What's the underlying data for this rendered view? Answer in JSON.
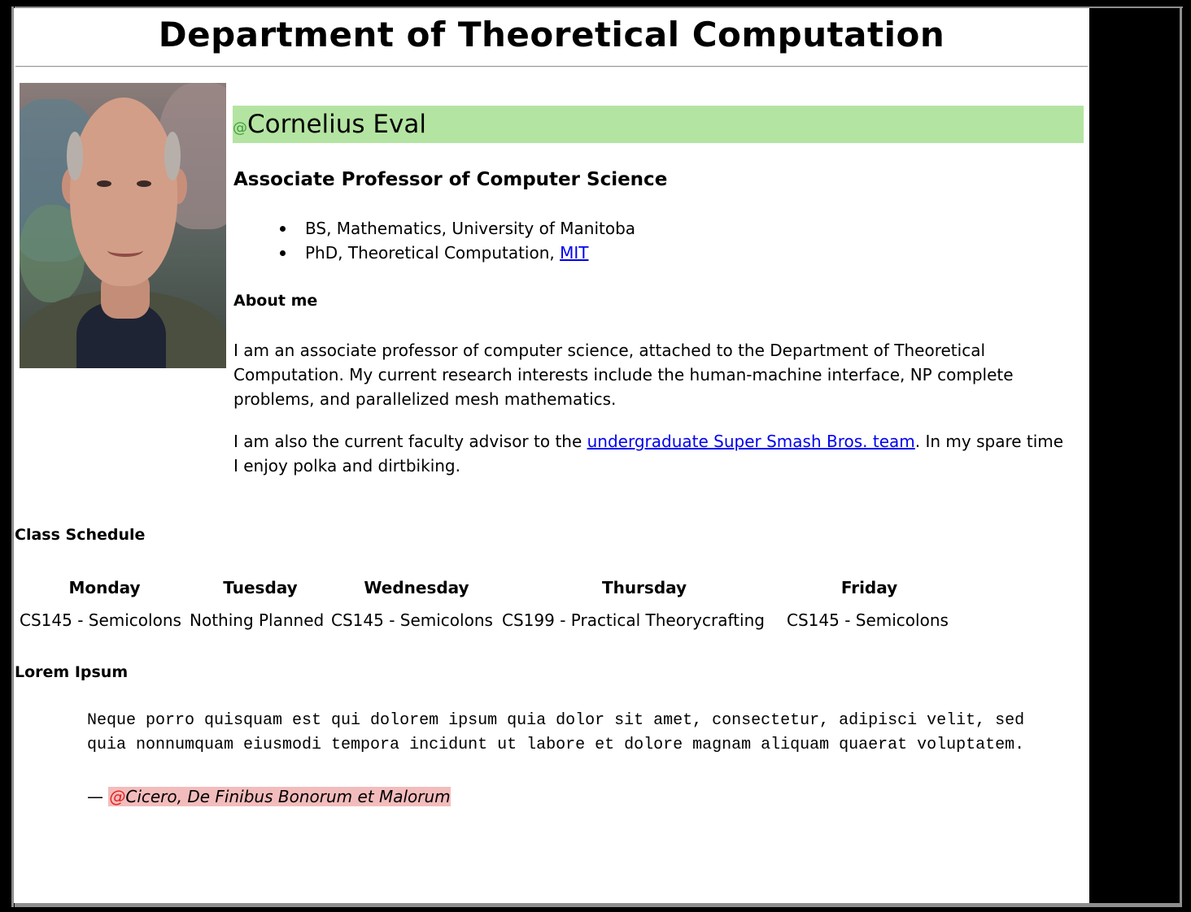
{
  "department_title": "Department of Theoretical Computation",
  "profile": {
    "name_prefix": "@",
    "name": "Cornelius Eval",
    "role": "Associate Professor of Computer Science",
    "degrees": [
      {
        "text": "BS, Mathematics, University of Manitoba",
        "link": ""
      },
      {
        "text": "PhD, Theoretical Computation, ",
        "link": "MIT"
      }
    ]
  },
  "about": {
    "heading": "About me",
    "p1": "I am an associate professor of computer science, attached to the Department of Theoretical Computation. My current research interests include the human-machine interface, NP complete problems, and parallelized mesh mathematics.",
    "p2_before": "I am also the current faculty advisor to the ",
    "p2_link": "undergraduate Super Smash Bros. team",
    "p2_after": ". In my spare time I enjoy polka and dirtbiking."
  },
  "schedule": {
    "heading": "Class Schedule",
    "days": [
      "Monday",
      "Tuesday",
      "Wednesday",
      "Thursday",
      "Friday"
    ],
    "classes": [
      "CS145 - Semicolons",
      "Nothing Planned",
      "CS145 - Semicolons",
      "CS199 - Practical Theorycrafting",
      "CS145 - Semicolons"
    ]
  },
  "lorem": {
    "heading": "Lorem Ipsum",
    "quote": "Neque porro quisquam est qui dolorem ipsum quia dolor sit amet, consectetur, adipisci velit, sed quia nonnumquam eiusmodi tempora incidunt ut labore et dolore magnam aliquam quaerat voluptatem.",
    "dash": "— ",
    "cite_prefix": "@",
    "cite": "Cicero, De Finibus Bonorum et Malorum"
  },
  "colors": {
    "name_highlight": "#b4e4a2",
    "cite_highlight": "#f3bcbc",
    "link": "#0000ee"
  }
}
